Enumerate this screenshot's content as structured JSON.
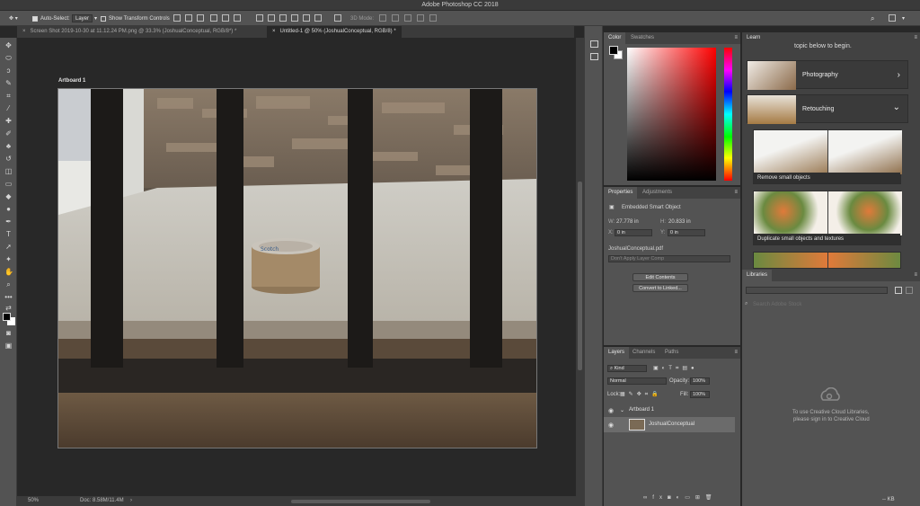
{
  "app": {
    "title": "Adobe Photoshop CC 2018"
  },
  "options": {
    "auto_select_label": "Auto-Select:",
    "auto_select_value": "Layer",
    "show_transform_label": "Show Transform Controls",
    "mode_3d": "3D Mode:"
  },
  "doc_tabs": [
    {
      "label": "Screen Shot 2019-10-30 at 11.12.24 PM.png @ 33.3% (JoshualConceptual, RGB/8*) *",
      "active": false
    },
    {
      "label": "Untitled-1 @ 50% (JoshualConceptual, RGB/8) *",
      "active": true
    }
  ],
  "canvas": {
    "artboard_label": "Artboard 1",
    "tape_text": "Scotch"
  },
  "status": {
    "zoom": "50%",
    "doc": "Doc: 8.58M/11.4M",
    "arrow": "›"
  },
  "color_panel": {
    "tabs": [
      "Color",
      "Swatches"
    ],
    "fg": "#000000",
    "bg": "#ffffff"
  },
  "properties_panel": {
    "tabs": [
      "Properties",
      "Adjustments"
    ],
    "object_type": "Embedded Smart Object",
    "w_label": "W:",
    "w_value": "27.778 in",
    "h_label": "H:",
    "h_value": "20.833 in",
    "x_label": "X:",
    "x_value": "0 in",
    "y_label": "Y:",
    "y_value": "0 in",
    "filename": "JoshualConceptual.pdf",
    "layer_comp": "Don't Apply Layer Comp",
    "edit_contents": "Edit Contents",
    "convert": "Convert to Linked..."
  },
  "layers_panel": {
    "tabs": [
      "Layers",
      "Channels",
      "Paths"
    ],
    "kind": "Kind",
    "blend": "Normal",
    "opacity_label": "Opacity:",
    "opacity_value": "100%",
    "lock_label": "Lock:",
    "fill_label": "Fill:",
    "fill_value": "100%",
    "layers": [
      {
        "name": "Artboard 1",
        "type": "artboard"
      },
      {
        "name": "JoshualConceptual",
        "type": "smart-object"
      }
    ]
  },
  "learn_panel": {
    "tab": "Learn",
    "intro": "topic below to begin.",
    "topics": [
      {
        "label": "Photography",
        "chevron": "›"
      },
      {
        "label": "Retouching",
        "chevron": "⌄"
      }
    ],
    "tutorials": [
      {
        "label": "Remove small objects"
      },
      {
        "label": "Duplicate small objects and textures"
      }
    ]
  },
  "libraries_panel": {
    "tab": "Libraries",
    "search_placeholder": "Search Adobe Stock",
    "message_line1": "To use Creative Cloud Libraries,",
    "message_line2": "please sign in to Creative Cloud",
    "footer": "-- KB"
  }
}
